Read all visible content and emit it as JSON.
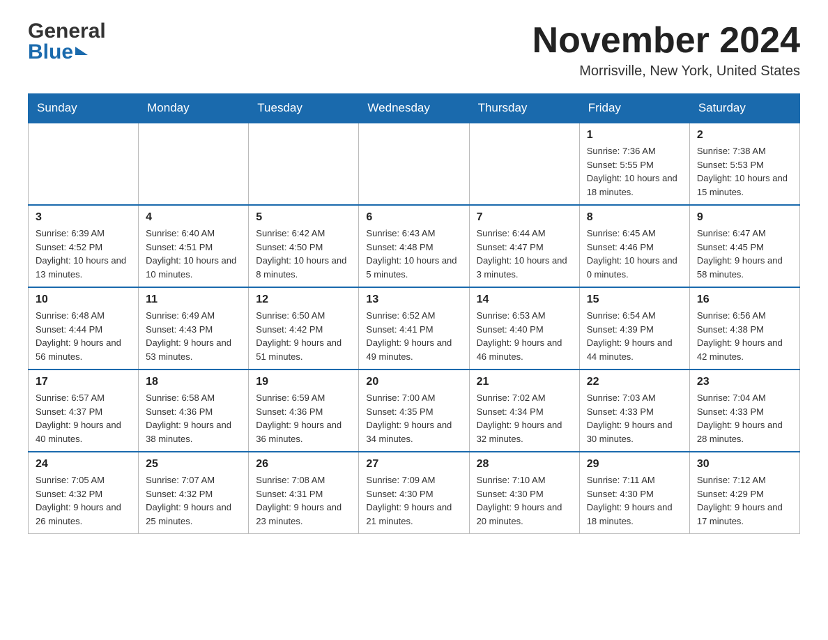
{
  "header": {
    "logo_general": "General",
    "logo_blue": "Blue",
    "month_title": "November 2024",
    "location": "Morrisville, New York, United States"
  },
  "calendar": {
    "days_of_week": [
      "Sunday",
      "Monday",
      "Tuesday",
      "Wednesday",
      "Thursday",
      "Friday",
      "Saturday"
    ],
    "weeks": [
      {
        "days": [
          {
            "number": "",
            "info": ""
          },
          {
            "number": "",
            "info": ""
          },
          {
            "number": "",
            "info": ""
          },
          {
            "number": "",
            "info": ""
          },
          {
            "number": "",
            "info": ""
          },
          {
            "number": "1",
            "info": "Sunrise: 7:36 AM\nSunset: 5:55 PM\nDaylight: 10 hours and 18 minutes."
          },
          {
            "number": "2",
            "info": "Sunrise: 7:38 AM\nSunset: 5:53 PM\nDaylight: 10 hours and 15 minutes."
          }
        ]
      },
      {
        "days": [
          {
            "number": "3",
            "info": "Sunrise: 6:39 AM\nSunset: 4:52 PM\nDaylight: 10 hours and 13 minutes."
          },
          {
            "number": "4",
            "info": "Sunrise: 6:40 AM\nSunset: 4:51 PM\nDaylight: 10 hours and 10 minutes."
          },
          {
            "number": "5",
            "info": "Sunrise: 6:42 AM\nSunset: 4:50 PM\nDaylight: 10 hours and 8 minutes."
          },
          {
            "number": "6",
            "info": "Sunrise: 6:43 AM\nSunset: 4:48 PM\nDaylight: 10 hours and 5 minutes."
          },
          {
            "number": "7",
            "info": "Sunrise: 6:44 AM\nSunset: 4:47 PM\nDaylight: 10 hours and 3 minutes."
          },
          {
            "number": "8",
            "info": "Sunrise: 6:45 AM\nSunset: 4:46 PM\nDaylight: 10 hours and 0 minutes."
          },
          {
            "number": "9",
            "info": "Sunrise: 6:47 AM\nSunset: 4:45 PM\nDaylight: 9 hours and 58 minutes."
          }
        ]
      },
      {
        "days": [
          {
            "number": "10",
            "info": "Sunrise: 6:48 AM\nSunset: 4:44 PM\nDaylight: 9 hours and 56 minutes."
          },
          {
            "number": "11",
            "info": "Sunrise: 6:49 AM\nSunset: 4:43 PM\nDaylight: 9 hours and 53 minutes."
          },
          {
            "number": "12",
            "info": "Sunrise: 6:50 AM\nSunset: 4:42 PM\nDaylight: 9 hours and 51 minutes."
          },
          {
            "number": "13",
            "info": "Sunrise: 6:52 AM\nSunset: 4:41 PM\nDaylight: 9 hours and 49 minutes."
          },
          {
            "number": "14",
            "info": "Sunrise: 6:53 AM\nSunset: 4:40 PM\nDaylight: 9 hours and 46 minutes."
          },
          {
            "number": "15",
            "info": "Sunrise: 6:54 AM\nSunset: 4:39 PM\nDaylight: 9 hours and 44 minutes."
          },
          {
            "number": "16",
            "info": "Sunrise: 6:56 AM\nSunset: 4:38 PM\nDaylight: 9 hours and 42 minutes."
          }
        ]
      },
      {
        "days": [
          {
            "number": "17",
            "info": "Sunrise: 6:57 AM\nSunset: 4:37 PM\nDaylight: 9 hours and 40 minutes."
          },
          {
            "number": "18",
            "info": "Sunrise: 6:58 AM\nSunset: 4:36 PM\nDaylight: 9 hours and 38 minutes."
          },
          {
            "number": "19",
            "info": "Sunrise: 6:59 AM\nSunset: 4:36 PM\nDaylight: 9 hours and 36 minutes."
          },
          {
            "number": "20",
            "info": "Sunrise: 7:00 AM\nSunset: 4:35 PM\nDaylight: 9 hours and 34 minutes."
          },
          {
            "number": "21",
            "info": "Sunrise: 7:02 AM\nSunset: 4:34 PM\nDaylight: 9 hours and 32 minutes."
          },
          {
            "number": "22",
            "info": "Sunrise: 7:03 AM\nSunset: 4:33 PM\nDaylight: 9 hours and 30 minutes."
          },
          {
            "number": "23",
            "info": "Sunrise: 7:04 AM\nSunset: 4:33 PM\nDaylight: 9 hours and 28 minutes."
          }
        ]
      },
      {
        "days": [
          {
            "number": "24",
            "info": "Sunrise: 7:05 AM\nSunset: 4:32 PM\nDaylight: 9 hours and 26 minutes."
          },
          {
            "number": "25",
            "info": "Sunrise: 7:07 AM\nSunset: 4:32 PM\nDaylight: 9 hours and 25 minutes."
          },
          {
            "number": "26",
            "info": "Sunrise: 7:08 AM\nSunset: 4:31 PM\nDaylight: 9 hours and 23 minutes."
          },
          {
            "number": "27",
            "info": "Sunrise: 7:09 AM\nSunset: 4:30 PM\nDaylight: 9 hours and 21 minutes."
          },
          {
            "number": "28",
            "info": "Sunrise: 7:10 AM\nSunset: 4:30 PM\nDaylight: 9 hours and 20 minutes."
          },
          {
            "number": "29",
            "info": "Sunrise: 7:11 AM\nSunset: 4:30 PM\nDaylight: 9 hours and 18 minutes."
          },
          {
            "number": "30",
            "info": "Sunrise: 7:12 AM\nSunset: 4:29 PM\nDaylight: 9 hours and 17 minutes."
          }
        ]
      }
    ]
  }
}
